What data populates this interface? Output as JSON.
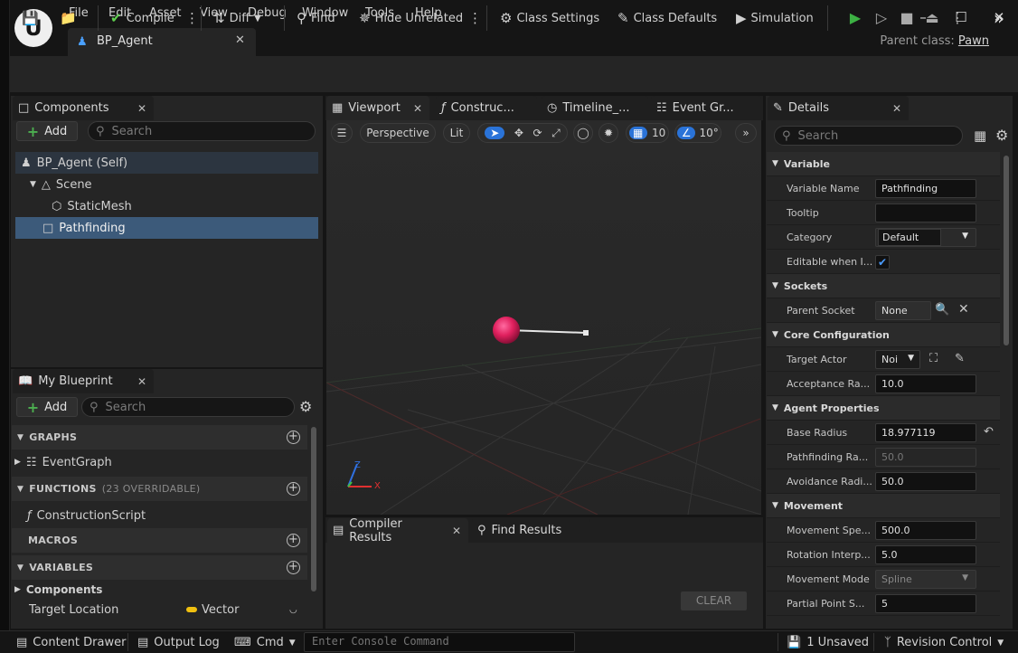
{
  "menu": [
    "File",
    "Edit",
    "Asset",
    "View",
    "Debug",
    "Window",
    "Tools",
    "Help"
  ],
  "document_tab": {
    "title": "BP_Agent"
  },
  "parent_class": {
    "label": "Parent class:",
    "value": "Pawn"
  },
  "toolbar": {
    "compile": "Compile",
    "diff": "Diff",
    "find": "Find",
    "hide_unrelated": "Hide Unrelated",
    "class_settings": "Class Settings",
    "class_defaults": "Class Defaults",
    "simulation": "Simulation"
  },
  "components": {
    "tab": "Components",
    "add": "Add",
    "search_placeholder": "Search",
    "items": [
      {
        "label": "BP_Agent (Self)"
      },
      {
        "label": "Scene"
      },
      {
        "label": "StaticMesh"
      },
      {
        "label": "Pathfinding"
      }
    ]
  },
  "my_blueprint": {
    "tab": "My Blueprint",
    "add": "Add",
    "search_placeholder": "Search",
    "graphs": "GRAPHS",
    "event_graph": "EventGraph",
    "functions": "FUNCTIONS",
    "functions_count": "(23 OVERRIDABLE)",
    "construction_script": "ConstructionScript",
    "macros": "MACROS",
    "variables": "VARIABLES",
    "components_cat": "Components",
    "var_name": "Target Location",
    "var_type": "Vector"
  },
  "viewport": {
    "tabs": [
      "Viewport",
      "Construc...",
      "Timeline_...",
      "Event Gr..."
    ],
    "perspective": "Perspective",
    "lit": "Lit",
    "grid_size": "10",
    "angle": "10°",
    "axis_z": "Z",
    "axis_x": "X"
  },
  "bottom": {
    "compiler_results": "Compiler Results",
    "find_results": "Find Results",
    "clear": "CLEAR"
  },
  "details": {
    "tab": "Details",
    "search_placeholder": "Search",
    "sections": [
      {
        "title": "Variable",
        "rows": [
          {
            "key": "Variable Name",
            "value": "Pathfinding"
          },
          {
            "key": "Tooltip",
            "value": ""
          },
          {
            "key": "Category",
            "value": "Default"
          },
          {
            "key": "Editable when I...",
            "value": "checked"
          }
        ]
      },
      {
        "title": "Sockets",
        "rows": [
          {
            "key": "Parent Socket",
            "value": "None"
          }
        ]
      },
      {
        "title": "Core Configuration",
        "rows": [
          {
            "key": "Target Actor",
            "value": "Noi"
          },
          {
            "key": "Acceptance Ra...",
            "value": "10.0"
          }
        ]
      },
      {
        "title": "Agent Properties",
        "rows": [
          {
            "key": "Base Radius",
            "value": "18.977119"
          },
          {
            "key": "Pathfinding Ra...",
            "value": "50.0"
          },
          {
            "key": "Avoidance Radi...",
            "value": "50.0"
          }
        ]
      },
      {
        "title": "Movement",
        "rows": [
          {
            "key": "Movement Spe...",
            "value": "500.0"
          },
          {
            "key": "Rotation Interp...",
            "value": "5.0"
          },
          {
            "key": "Movement Mode",
            "value": "Spline"
          },
          {
            "key": "Partial Point S...",
            "value": "5"
          }
        ]
      }
    ]
  },
  "statusbar": {
    "content_drawer": "Content Drawer",
    "output_log": "Output Log",
    "cmd": "Cmd",
    "console_placeholder": "Enter Console Command",
    "unsaved": "1 Unsaved",
    "revision_control": "Revision Control"
  },
  "colors": {
    "accent": "#2a73d8",
    "selection": "#3c5a7a",
    "play": "#3cb043",
    "sphere": "#e0205e",
    "bg": "#151515",
    "panel": "#252525"
  }
}
